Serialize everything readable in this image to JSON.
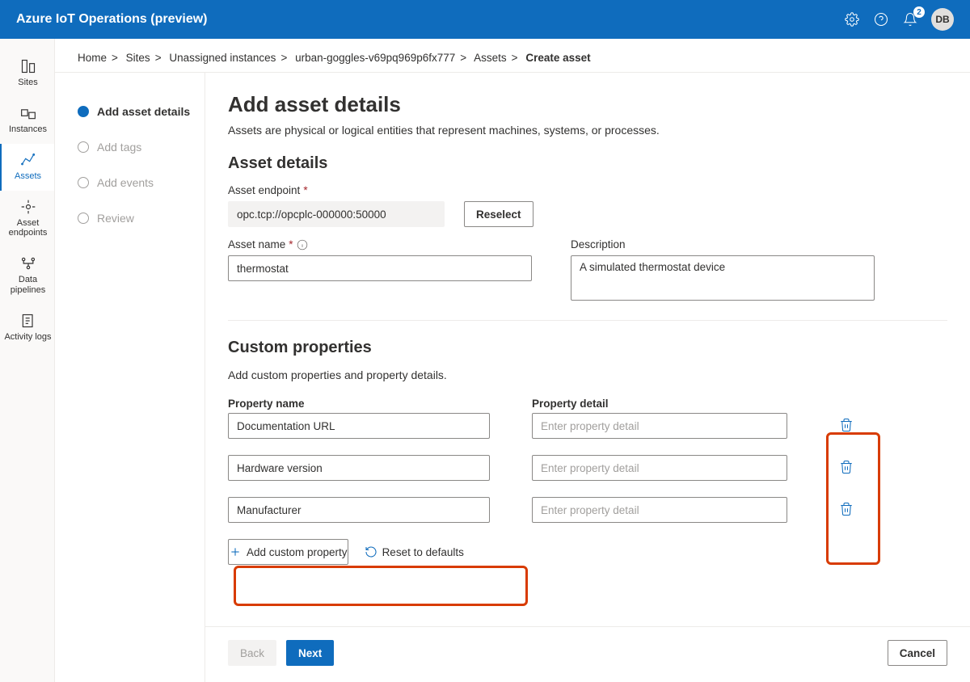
{
  "topbar": {
    "title": "Azure IoT Operations (preview)",
    "notification_count": "2",
    "avatar_initials": "DB"
  },
  "leftnav": {
    "items": [
      {
        "label": "Sites"
      },
      {
        "label": "Instances"
      },
      {
        "label": "Assets"
      },
      {
        "label": "Asset endpoints"
      },
      {
        "label": "Data pipelines"
      },
      {
        "label": "Activity logs"
      }
    ]
  },
  "breadcrumb": {
    "items": [
      "Home",
      "Sites",
      "Unassigned instances",
      "urban-goggles-v69pq969p6fx777",
      "Assets"
    ],
    "current": "Create asset"
  },
  "wizard": {
    "steps": [
      {
        "label": "Add asset details",
        "active": true
      },
      {
        "label": "Add tags",
        "active": false
      },
      {
        "label": "Add events",
        "active": false
      },
      {
        "label": "Review",
        "active": false
      }
    ]
  },
  "form": {
    "title": "Add asset details",
    "subtitle": "Assets are physical or logical entities that represent machines, systems, or processes.",
    "section1_title": "Asset details",
    "endpoint_label": "Asset endpoint",
    "endpoint_value": "opc.tcp://opcplc-000000:50000",
    "reselect_label": "Reselect",
    "name_label": "Asset name",
    "name_value": "thermostat",
    "desc_label": "Description",
    "desc_value": "A simulated thermostat device",
    "section2_title": "Custom properties",
    "section2_sub": "Add custom properties and property details.",
    "propname_header": "Property name",
    "propdetail_header": "Property detail",
    "detail_placeholder": "Enter property detail",
    "properties": [
      {
        "name": "Documentation URL",
        "detail": ""
      },
      {
        "name": "Hardware version",
        "detail": ""
      },
      {
        "name": "Manufacturer",
        "detail": ""
      }
    ],
    "add_custom_label": "Add custom property",
    "reset_label": "Reset to defaults"
  },
  "footer": {
    "back": "Back",
    "next": "Next",
    "cancel": "Cancel"
  }
}
